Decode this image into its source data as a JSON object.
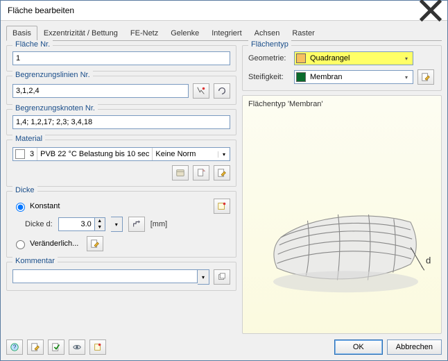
{
  "window": {
    "title": "Fläche bearbeiten",
    "close_tooltip": "Schließen"
  },
  "tabs": {
    "items": [
      "Basis",
      "Exzentrizität / Bettung",
      "FE-Netz",
      "Gelenke",
      "Integriert",
      "Achsen",
      "Raster"
    ],
    "active_index": 0
  },
  "left": {
    "surface_no": {
      "legend": "Fläche Nr.",
      "value": "1"
    },
    "boundary_lines": {
      "legend": "Begrenzungslinien Nr.",
      "value": "3,1,2,4"
    },
    "boundary_nodes": {
      "legend": "Begrenzungsknoten Nr.",
      "value": "1,4; 1,2,17; 2,3; 3,4,18"
    },
    "material": {
      "legend": "Material",
      "index": "3",
      "name": "PVB 22 °C Belastung bis 10 sec",
      "standard": "Keine Norm"
    },
    "thickness": {
      "legend": "Dicke",
      "mode_constant": "Konstant",
      "mode_variable": "Veränderlich...",
      "d_label": "Dicke d:",
      "d_value": "3.0",
      "unit": "[mm]"
    },
    "comment": {
      "legend": "Kommentar",
      "value": ""
    }
  },
  "right": {
    "legend": "Flächentyp",
    "geometry_label": "Geometrie:",
    "geometry_value": "Quadrangel",
    "stiffness_label": "Steifigkeit:",
    "stiffness_value": "Membran",
    "preview_caption": "Flächentyp 'Membran'",
    "d_marker": "d"
  },
  "footer": {
    "ok": "OK",
    "cancel": "Abbrechen"
  }
}
